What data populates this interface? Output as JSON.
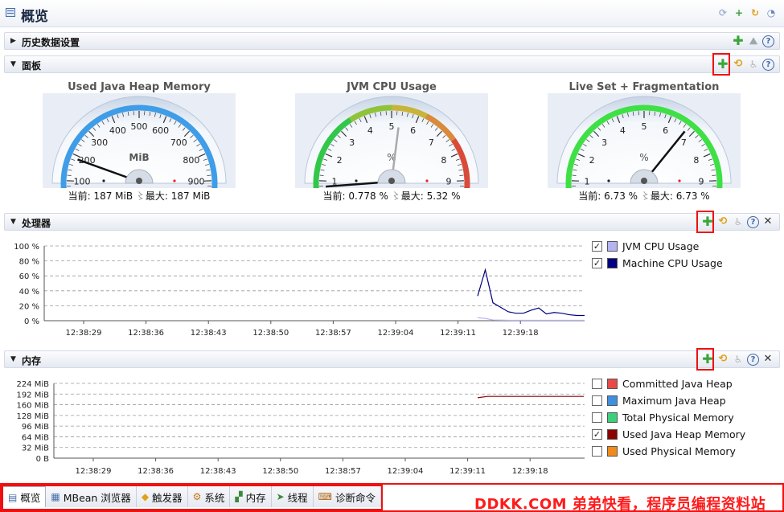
{
  "window": {
    "title": "概览"
  },
  "sections": {
    "history": {
      "title": "历史数据设置"
    },
    "dashboard": {
      "title": "面板"
    },
    "processor": {
      "title": "处理器"
    },
    "memory": {
      "title": "内存"
    }
  },
  "gauges": [
    {
      "title": "Used Java Heap Memory",
      "unit": "MiB",
      "ticks": [
        "0",
        "100",
        "200",
        "300",
        "400",
        "500",
        "600",
        "700",
        "800",
        "900",
        "1000"
      ],
      "min": 0,
      "max": 1000,
      "current": 187,
      "max_value": 187,
      "readout": "当前: 187 MiB ",
      "readout_max": "最大: 187 MiB",
      "arc": "blue"
    },
    {
      "title": "JVM CPU Usage",
      "unit": "%",
      "ticks": [
        "0",
        "1",
        "2",
        "3",
        "4",
        "5",
        "6",
        "7",
        "8",
        "9",
        "10"
      ],
      "min": 0,
      "max": 10,
      "current": 0.778,
      "max_value": 5.32,
      "readout": "当前: 0.778 % ",
      "readout_max": "最大: 5.32 %",
      "arc": "traffic"
    },
    {
      "title": "Live Set + Fragmentation",
      "unit": "%",
      "ticks": [
        "0",
        "1",
        "2",
        "3",
        "4",
        "5",
        "6",
        "7",
        "8",
        "9",
        "10"
      ],
      "min": 0,
      "max": 10,
      "current": 6.73,
      "max_value": 6.73,
      "readout": "当前: 6.73 % ",
      "readout_max": "最大: 6.73 %",
      "arc": "green"
    }
  ],
  "processor_chart": {
    "chart_data": {
      "type": "line",
      "y_ticks": [
        "100 %",
        "80 %",
        "60 %",
        "40 %",
        "20 %",
        "0 %"
      ],
      "ylim": [
        0,
        100
      ],
      "x_ticks": [
        "12:38:29",
        "12:38:36",
        "12:38:43",
        "12:38:50",
        "12:38:57",
        "12:39:04",
        "12:39:11",
        "12:39:18"
      ],
      "x_values": [
        0,
        1,
        2,
        3,
        4,
        5,
        6,
        7,
        8,
        9,
        10,
        11,
        12,
        13,
        14
      ],
      "series": [
        {
          "name": "JVM CPU Usage",
          "color": "#b4b4f0",
          "values": [
            4,
            3,
            1,
            0.8,
            0.6,
            0.5,
            0.5,
            0.5,
            0.5,
            0.5,
            0.5,
            0.5,
            0.5,
            0.5,
            0.5
          ]
        },
        {
          "name": "Machine CPU Usage",
          "color": "#000080",
          "values": [
            33,
            68,
            24,
            18,
            12,
            10,
            10,
            14,
            17,
            9,
            11,
            10,
            8,
            7,
            7
          ]
        }
      ]
    },
    "legend": [
      {
        "label": "JVM CPU Usage",
        "checked": true,
        "color": "#b4b4f0"
      },
      {
        "label": "Machine CPU Usage",
        "checked": true,
        "color": "#000080"
      }
    ]
  },
  "memory_chart": {
    "chart_data": {
      "type": "line",
      "y_ticks": [
        "224 MiB",
        "192 MiB",
        "160 MiB",
        "128 MiB",
        "96 MiB",
        "64 MiB",
        "32 MiB",
        "0 B"
      ],
      "ylim": [
        0,
        224
      ],
      "x_ticks": [
        "12:38:29",
        "12:38:36",
        "12:38:43",
        "12:38:50",
        "12:38:57",
        "12:39:04",
        "12:39:11",
        "12:39:18"
      ],
      "series": [
        {
          "name": "Used Java Heap Memory",
          "color": "#8b0000",
          "values": [
            181,
            185,
            185,
            185,
            185,
            185,
            185,
            185,
            185,
            185,
            185,
            185
          ]
        }
      ]
    },
    "legend": [
      {
        "label": "Committed Java Heap",
        "checked": false,
        "color": "#e84a4a"
      },
      {
        "label": "Maximum Java Heap",
        "checked": false,
        "color": "#3f8fe0"
      },
      {
        "label": "Total Physical Memory",
        "checked": false,
        "color": "#3ccf7c"
      },
      {
        "label": "Used Java Heap Memory",
        "checked": true,
        "color": "#8b0000"
      },
      {
        "label": "Used Physical Memory",
        "checked": false,
        "color": "#f08a1a"
      }
    ]
  },
  "tabs": [
    {
      "label": "概览",
      "icon": "overview-icon",
      "active": true
    },
    {
      "label": "MBean 浏览器",
      "icon": "mbean-icon",
      "active": false
    },
    {
      "label": "触发器",
      "icon": "trigger-icon",
      "active": false
    },
    {
      "label": "系统",
      "icon": "system-icon",
      "active": false
    },
    {
      "label": "内存",
      "icon": "memory-icon",
      "active": false
    },
    {
      "label": "线程",
      "icon": "threads-icon",
      "active": false
    },
    {
      "label": "诊断命令",
      "icon": "diagnostic-icon",
      "active": false
    }
  ],
  "watermark": "DDKK.COM 弟弟快看，程序员编程资料站"
}
